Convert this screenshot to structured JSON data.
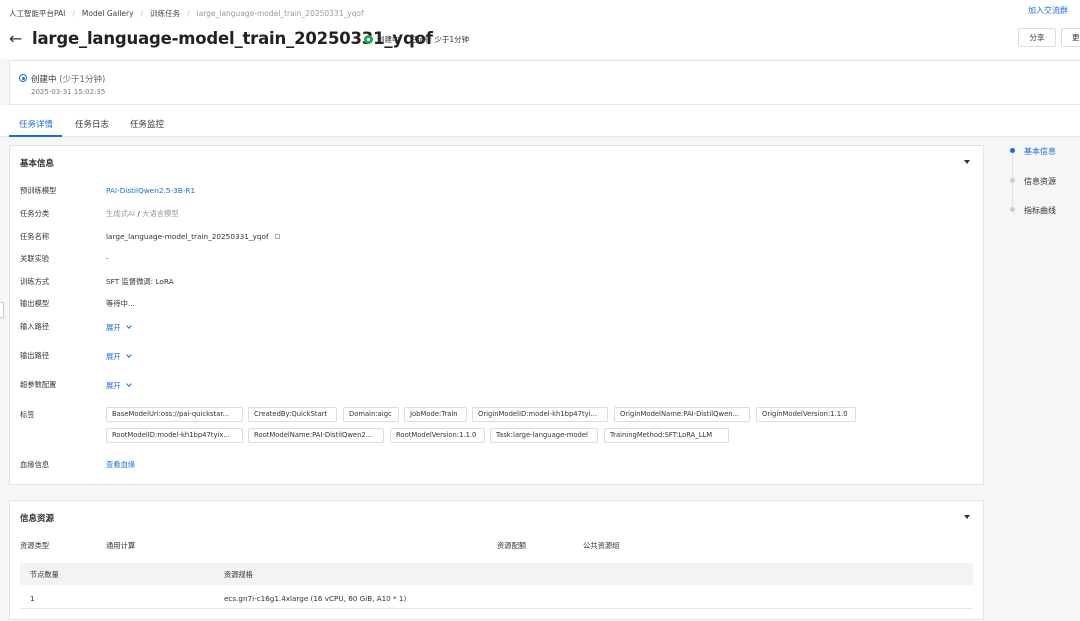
{
  "breadcrumb": {
    "items": [
      "人工智能平台PAI",
      "Model Gallery",
      "训练任务"
    ],
    "current": "large_language-model_train_20250331_yqof"
  },
  "top_link": "加入交流群",
  "header": {
    "title": "large_language-model_train_20250331_yqof",
    "status": "创建中",
    "runtime": "已运行 少于1分钟",
    "share_label": "分享",
    "more_label": "更"
  },
  "state": {
    "label": "创建中",
    "sub": "(少于1分钟)",
    "time": "2025-03-31 15:02:35"
  },
  "tabs": [
    "任务详情",
    "任务日志",
    "任务监控"
  ],
  "basic_info": {
    "heading": "基本信息",
    "rows": [
      {
        "label": "预训练模型",
        "value": "PAI-DistilQwen2.5-3B-R1"
      },
      {
        "label": "任务分类",
        "value_a": "生成式AI",
        "sep": "/",
        "value_b": "大语言模型"
      },
      {
        "label": "任务名称",
        "value": "large_language-model_train_20250331_yqof"
      },
      {
        "label": "关联实验",
        "value": "-"
      },
      {
        "label": "训练方式",
        "value": "SFT 监督微调: LoRA"
      },
      {
        "label": "输出模型",
        "value": "等待中..."
      },
      {
        "label": "输入路径",
        "value": "展开"
      },
      {
        "label": "输出路径",
        "value": "展开"
      },
      {
        "label": "超参数配置",
        "value": "展开"
      },
      {
        "label": "标签"
      },
      {
        "label": "血缘信息",
        "value": "查看血缘"
      }
    ],
    "tags": [
      "BaseModelUri:oss://pai-quickstar...",
      "CreatedBy:QuickStart",
      "Domain:aigc",
      "JobMode:Train",
      "OriginModelID:model-kh1bp47tyi...",
      "OriginModelName:PAI-DistilQwen...",
      "OriginModelVersion:1.1.0",
      "RootModelID:model-kh1bp47tyix...",
      "RootModelName:PAI-DistilQwen2...",
      "RootModelVersion:1.1.0",
      "Task:large-language-model",
      "TrainingMethod:SFT:LoRA_LLM"
    ]
  },
  "resources": {
    "heading": "信息资源",
    "type_label": "资源类型",
    "type_value": "通用计算",
    "quota_label": "资源配额",
    "quota_value": "公共资源组",
    "columns": [
      "节点数量",
      "资源规格"
    ],
    "rows": [
      [
        "1",
        "ecs.gn7i-c16g1.4xlarge (16 vCPU, 60 GiB, A10 * 1)"
      ]
    ]
  },
  "anchor_nav": [
    "基本信息",
    "信息资源",
    "指标曲线"
  ]
}
